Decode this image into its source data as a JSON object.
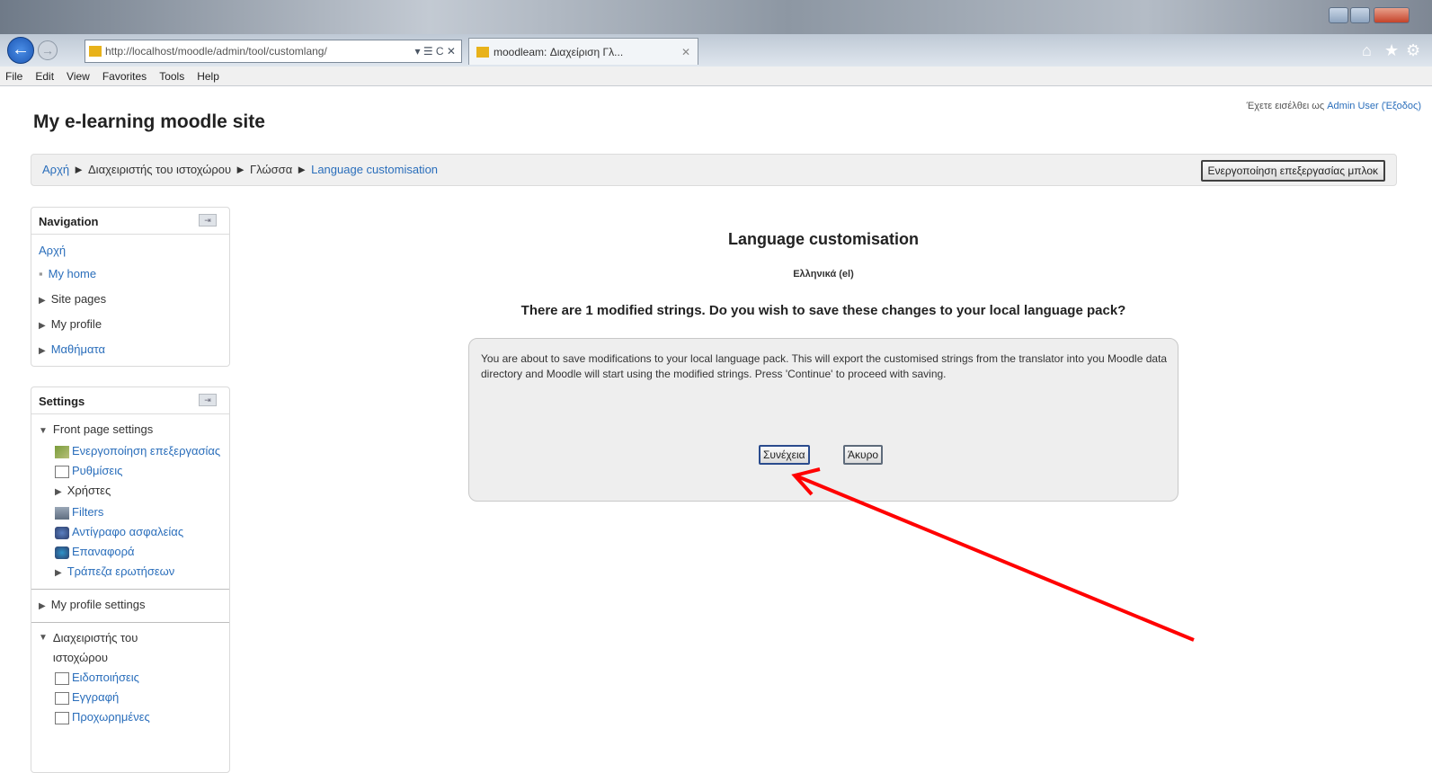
{
  "browser": {
    "url": "http://localhost/moodle/admin/tool/customlang/",
    "url_actions": "▾ ☰ C ✕",
    "tab_title": "moodleam: Διαχείριση Γλ...",
    "menu": [
      "File",
      "Edit",
      "View",
      "Favorites",
      "Tools",
      "Help"
    ],
    "accent": "#1d57b4"
  },
  "site": {
    "title": "My e-learning moodle site",
    "login_prefix": "Έχετε εισέλθει ως",
    "login_user": "Admin User",
    "logout": "(Έξοδος)"
  },
  "breadcrumb": {
    "items": [
      "Αρχή",
      "Διαχειριστής του ιστοχώρου",
      "Γλώσσα",
      "Language customisation"
    ],
    "separator": "►"
  },
  "edit_button_label": "Ενεργοποίηση επεξεργασίας μπλοκ",
  "navigation": {
    "title": "Navigation",
    "home": "Αρχή",
    "items": [
      "My home",
      "Site pages",
      "My profile",
      "Μαθήματα"
    ]
  },
  "settings": {
    "title": "Settings",
    "front_page": "Front page settings",
    "front_items": [
      "Ενεργοποίηση επεξεργασίας",
      "Ρυθμίσεις",
      "Χρήστες",
      "Filters",
      "Αντίγραφο ασφαλείας",
      "Επαναφορά",
      "Τράπεζα ερωτήσεων"
    ],
    "my_profile": "My profile settings",
    "site_admin": "Διαχειριστής του ιστοχώρου",
    "admin_items": [
      "Ειδοποιήσεις",
      "Εγγραφή",
      "Προχωρημένες"
    ]
  },
  "main": {
    "heading": "Language customisation",
    "language": "Ελληνικά (el)",
    "question": "There are 1 modified strings. Do you wish to save these changes to your local language pack?",
    "message": "You are about to save modifications to your local language pack. This will export the customised strings from the translator into you Moodle data directory and Moodle will start using the modified strings. Press 'Continue' to proceed with saving.",
    "continue_label": "Συνέχεια",
    "cancel_label": "Άκυρο"
  },
  "annotation_color": "#ff0000"
}
